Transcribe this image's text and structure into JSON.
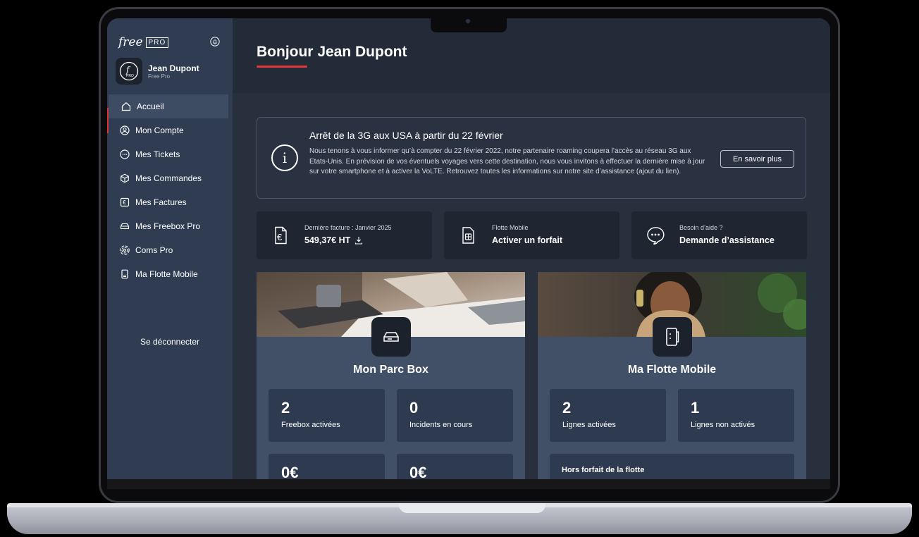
{
  "brand": {
    "logo_text": "free",
    "logo_badge": "PRO"
  },
  "user": {
    "name": "Jean Dupont",
    "org": "Free Pro"
  },
  "sidebar": {
    "items": [
      {
        "label": "Accueil",
        "icon": "home-icon"
      },
      {
        "label": "Mon Compte",
        "icon": "user-circle-icon"
      },
      {
        "label": "Mes Tickets",
        "icon": "chat-bubble-icon"
      },
      {
        "label": "Mes Commandes",
        "icon": "box-icon"
      },
      {
        "label": "Mes Factures",
        "icon": "euro-invoice-icon"
      },
      {
        "label": "Mes Freebox Pro",
        "icon": "freebox-icon"
      },
      {
        "label": "Coms Pro",
        "icon": "signal-icon"
      },
      {
        "label": "Ma Flotte Mobile",
        "icon": "phone-icon"
      }
    ],
    "active_index": 0,
    "logout_label": "Se déconnecter"
  },
  "header": {
    "greeting": "Bonjour Jean Dupont"
  },
  "alert": {
    "title": "Arrêt de la 3G aux USA à partir du 22 février",
    "body": "Nous tenons à vous informer qu’à compter du 22 février 2022, notre partenaire roaming coupera l’accès au réseau 3G aux Etats-Unis. En prévision de vos éventuels voyages vers cette destination, nous vous invitons à effectuer la dernière mise à jour sur votre smartphone et à activer la VoLTE. Retrouvez toutes les informations sur notre site d’assistance (ajout du lien).",
    "button": "En savoir plus"
  },
  "quick_links": [
    {
      "label": "Dernière facture : Janvier 2025",
      "value": "549,37€ HT"
    },
    {
      "label": "Flotte Mobile",
      "value": "Activer un forfait"
    },
    {
      "label": "Besoin d’aide ?",
      "value": "Demande d’assistance"
    }
  ],
  "cards": {
    "box": {
      "title": "Mon Parc Box",
      "stats": [
        {
          "num": "2",
          "label": "Freebox activées"
        },
        {
          "num": "0",
          "label": "Incidents en cours"
        },
        {
          "num": "0€",
          "label": ""
        },
        {
          "num": "0€",
          "label": ""
        }
      ]
    },
    "mobile": {
      "title": "Ma Flotte Mobile",
      "stats": [
        {
          "num": "2",
          "label": "Lignes activées"
        },
        {
          "num": "1",
          "label": "Lignes non activés"
        }
      ],
      "extra_label": "Hors forfait de la flotte"
    }
  },
  "colors": {
    "accent": "#e2383c",
    "sidebar": "#2f3c52",
    "background": "#28303e",
    "card": "#415067"
  }
}
